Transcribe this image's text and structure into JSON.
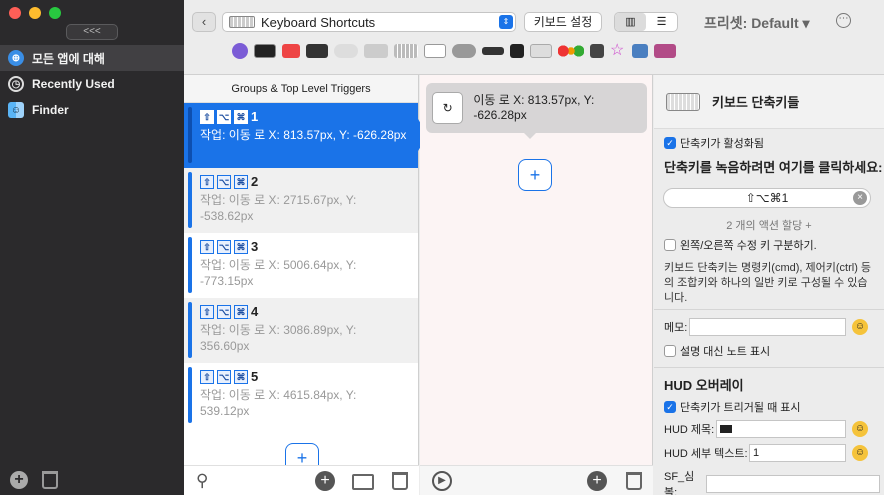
{
  "window": {
    "traffic_colors": [
      "#ff5f57",
      "#febc2e",
      "#28c840"
    ]
  },
  "sidebar": {
    "collapse_label": "<<<",
    "items": [
      {
        "label": "모든 앱에 대해",
        "icon": "globe-icon"
      },
      {
        "label": "Recently Used",
        "icon": "clock-icon"
      },
      {
        "label": "Finder",
        "icon": "finder-icon"
      }
    ]
  },
  "toolbar": {
    "back_label": "‹",
    "preset_select": "Keyboard Shortcuts",
    "kb_settings_label": "키보드 설정",
    "preset_label": "프리셋: Default ▾",
    "more_label": "⋯"
  },
  "groups": {
    "header": "Groups & Top Level Triggers",
    "triggers": [
      {
        "keys": "1",
        "desc": "작업: 이동 로  X: 813.57px, Y: -626.28px"
      },
      {
        "keys": "2",
        "desc": "작업: 이동 로  X: 2715.67px, Y: -538.62px"
      },
      {
        "keys": "3",
        "desc": "작업: 이동 로  X: 5006.64px, Y: -773.15px"
      },
      {
        "keys": "4",
        "desc": "작업: 이동 로  X: 3086.89px, Y: 356.60px"
      },
      {
        "keys": "5",
        "desc": "작업: 이동 로  X: 4615.84px, Y: 539.12px"
      }
    ]
  },
  "actions": {
    "card_text": "이동 로  X: 813.57px, Y: -626.28px"
  },
  "inspector": {
    "title": "키보드 단축키들",
    "enabled_label": "단축키가 활성화됨",
    "record_title": "단축키를 녹음하려면 여기를 클릭하세요:",
    "record_value": "⇧⌥⌘1",
    "assign_text": "2 개의 액션 할당 +",
    "distinguish_label": "왼쪽/오른쪽 수정 키 구분하기.",
    "help_text": "키보드 단축키는 명령키(cmd), 제어키(ctrl) 등의 조합키와 하나의 일반 키로 구성될 수 있습니다.",
    "memo_label": "메모:",
    "note_label": "설명 대신 노트 표시",
    "hud_title": "HUD 오버레이",
    "hud_show_label": "단축키가 트리거될 때 표시",
    "hud_title_label": "HUD 제목:",
    "hud_detail_label": "HUD 세부 텍스트:",
    "hud_detail_value": "1",
    "sf_label": "SF_심볼:"
  }
}
